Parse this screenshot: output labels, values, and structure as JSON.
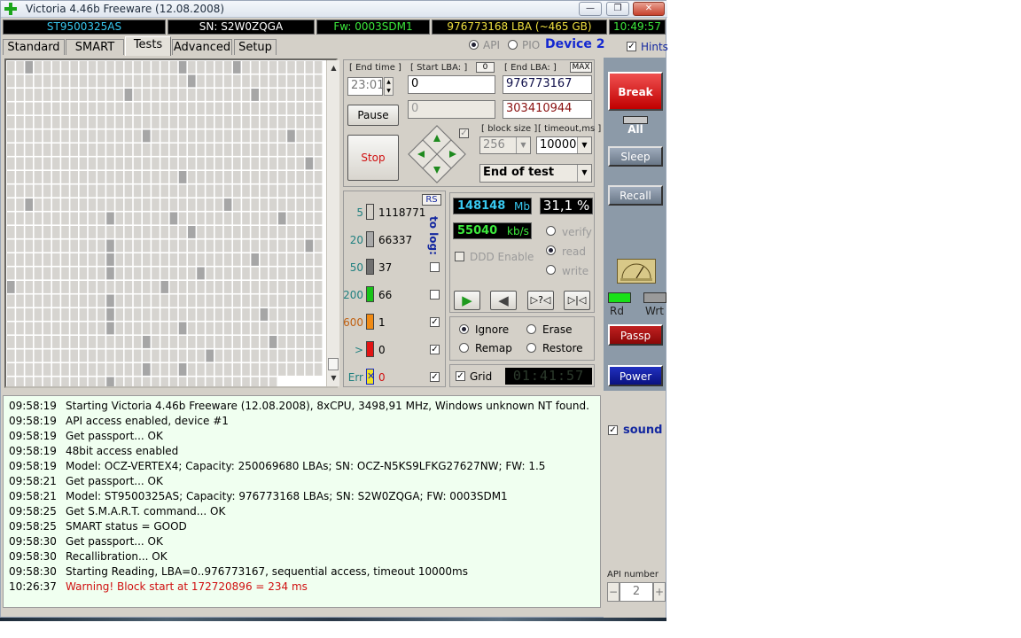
{
  "window": {
    "title": "Victoria 4.46b Freeware (12.08.2008)",
    "min_glyph": "—",
    "restore_glyph": "❐",
    "close_glyph": "✕"
  },
  "status_bar": {
    "model": "ST9500325AS",
    "serial": "SN: S2W0ZQGA",
    "firmware": "Fw: 0003SDM1",
    "lba": "976773168 LBA (~465 GB)",
    "clock": "10:49:57"
  },
  "tabs": [
    "Standard",
    "SMART",
    "Tests",
    "Advanced",
    "Setup"
  ],
  "active_tab": "Tests",
  "access": {
    "api_label": "API",
    "pio_label": "PIO",
    "device_label": "Device 2",
    "hints_label": "Hints"
  },
  "test_params": {
    "end_time_label": "[ End time ]",
    "end_time_value": "23:01",
    "start_lba_label": "[ Start LBA: ]",
    "start_lba_zero": "0",
    "start_lba_value": "0",
    "end_lba_label": "[ End LBA: ]",
    "end_lba_max": "MAX",
    "end_lba_value": "976773167",
    "current_lba_value": "0",
    "current_lba_red": "303410944",
    "pause_label": "Pause",
    "stop_label": "Stop",
    "block_size_label": "[ block size ]",
    "block_size_value": "256",
    "timeout_label": "[ timeout,ms ]",
    "timeout_value": "10000",
    "end_action_value": "End of test"
  },
  "latency": {
    "rs_label": "RS",
    "to_log_label": "to log:",
    "rows": [
      {
        "threshold": "5",
        "count": "1118771",
        "color": "#d4d0c8",
        "checked": false
      },
      {
        "threshold": "20",
        "count": "66337",
        "color": "#a8a8a8",
        "checked": false
      },
      {
        "threshold": "50",
        "count": "37",
        "color": "#707070",
        "checked": false
      },
      {
        "threshold": "200",
        "count": "66",
        "color": "#19c419",
        "checked": false
      },
      {
        "threshold": "600",
        "count": "1",
        "color": "#f08a14",
        "checked": true
      },
      {
        "threshold": ">",
        "count": "0",
        "color": "#e11414",
        "checked": true
      },
      {
        "threshold": "Err",
        "count": "0",
        "color": "#1428c8",
        "checked": true
      }
    ],
    "err_glyph": "✕",
    "check_glyph": "✓"
  },
  "progress": {
    "mb_value": "148148",
    "mb_unit": "Mb",
    "percent": "31,1 %",
    "speed_value": "55040",
    "speed_unit": "kb/s",
    "verify_label": "verify",
    "read_label": "read",
    "write_label": "write",
    "ddd_label": "DDD Enable",
    "play_glyph": "▶",
    "back_glyph": "◀",
    "seek_glyph": "▷?◁",
    "end_glyph": "▷|◁"
  },
  "actions": {
    "ignore_label": "Ignore",
    "erase_label": "Erase",
    "remap_label": "Remap",
    "restore_label": "Restore",
    "grid_label": "Grid",
    "timer": "01:41:57"
  },
  "right_panel": {
    "break_all_label": "Break All",
    "sleep_label": "Sleep",
    "recall_label": "Recall",
    "rd_label": "Rd",
    "wrt_label": "Wrt",
    "passp_label": "Passp",
    "power_label": "Power",
    "sound_label": "sound",
    "api_number_label": "API number",
    "api_number_value": "2",
    "minus_glyph": "−",
    "plus_glyph": "+"
  },
  "log": [
    {
      "time": "09:58:19",
      "text": "Starting Victoria 4.46b Freeware (12.08.2008), 8xCPU, 3498,91 MHz, Windows unknown NT found.",
      "warn": false
    },
    {
      "time": "09:58:19",
      "text": "API access enabled, device #1",
      "warn": false
    },
    {
      "time": "09:58:19",
      "text": "Get passport... OK",
      "warn": false
    },
    {
      "time": "09:58:19",
      "text": "48bit access enabled",
      "warn": false
    },
    {
      "time": "09:58:19",
      "text": "Model: OCZ-VERTEX4; Capacity: 250069680 LBAs; SN: OCZ-N5KS9LFKG27627NW; FW: 1.5",
      "warn": false
    },
    {
      "time": "09:58:21",
      "text": "Get passport... OK",
      "warn": false
    },
    {
      "time": "09:58:21",
      "text": "Model: ST9500325AS; Capacity: 976773168 LBAs; SN: S2W0ZQGA; FW: 0003SDM1",
      "warn": false
    },
    {
      "time": "09:58:25",
      "text": "Get S.M.A.R.T. command... OK",
      "warn": false
    },
    {
      "time": "09:58:25",
      "text": "SMART status = GOOD",
      "warn": false
    },
    {
      "time": "09:58:30",
      "text": "Get passport... OK",
      "warn": false
    },
    {
      "time": "09:58:30",
      "text": "Recallibration... OK",
      "warn": false
    },
    {
      "time": "09:58:30",
      "text": "Starting Reading, LBA=0..976773167, sequential access, timeout 10000ms",
      "warn": false
    },
    {
      "time": "10:26:37",
      "text": "Warning! Block start at 172720896 = 234 ms",
      "warn": true
    }
  ]
}
